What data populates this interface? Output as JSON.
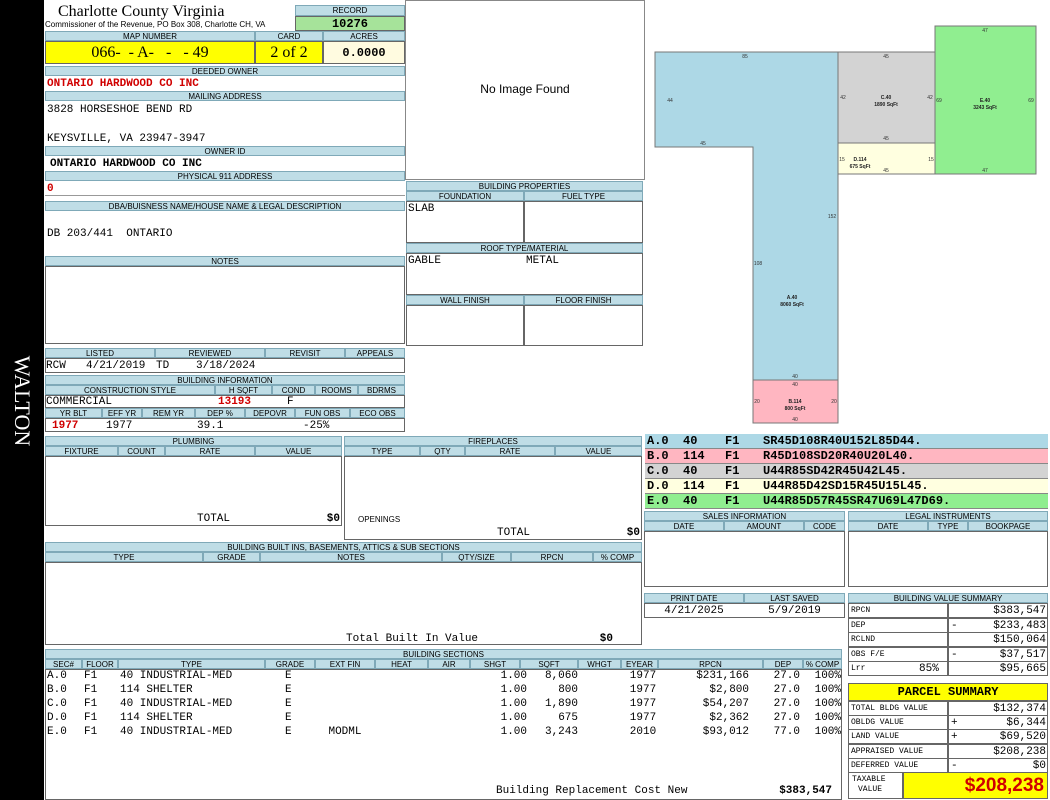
{
  "sidebar_name": "WALTON",
  "header": {
    "county": "Charlotte County Virginia",
    "address": "Commissioner of the Revenue, PO Box 308, Charlotte CH, VA",
    "record_label": "RECORD",
    "record": "10276"
  },
  "parcel": {
    "map_label": "MAP NUMBER",
    "map": "066-  - A-   -   - 49",
    "card_label": "CARD",
    "card": "2 of 2",
    "acres_label": "ACRES",
    "acres": "0.0000"
  },
  "owner": {
    "deeded_label": "DEEDED OWNER",
    "deeded": "ONTARIO HARDWOOD CO INC",
    "mailing_label": "MAILING ADDRESS",
    "addr1": "3828 HORSESHOE BEND RD",
    "addr2": "KEYSVILLE, VA 23947-3947",
    "owner_id_label": "OWNER ID",
    "owner_id": "ONTARIO HARDWOOD CO INC",
    "phys_label": "PHYSICAL 911 ADDRESS",
    "phys": "0"
  },
  "dba": {
    "label": "DBA/BUISNESS NAME/HOUSE NAME & LEGAL DESCRIPTION",
    "value": "DB 203/441  ONTARIO"
  },
  "notes": {
    "label": "NOTES"
  },
  "image": {
    "text": "No Image Found"
  },
  "bprops": {
    "title": "BUILDING PROPERTIES",
    "foundation_label": "FOUNDATION",
    "foundation": "SLAB",
    "fuel_label": "FUEL TYPE",
    "roof_label": "ROOF TYPE/MATERIAL",
    "roof_type": "GABLE",
    "roof_material": "METAL",
    "wall_label": "WALL FINISH",
    "floor_label": "FLOOR FINISH"
  },
  "review": {
    "listed_label": "LISTED",
    "listed_by": "RCW",
    "listed_date": "4/21/2019",
    "reviewed_label": "REVIEWED",
    "reviewed_by": "TD",
    "reviewed_date": "3/18/2024",
    "revisit_label": "REVISIT",
    "appeals_label": "APPEALS"
  },
  "binfo": {
    "title": "BUILDING INFORMATION",
    "cs_label": "CONSTRUCTION STYLE",
    "cs": "COMMERCIAL",
    "hsqft_label": "H SQFT",
    "hsqft": "13193",
    "cond_label": "COND",
    "cond": "F",
    "rooms_label": "ROOMS",
    "bdrms_label": "BDRMS",
    "yrblt_label": "YR BLT",
    "yrblt": "1977",
    "effyr_label": "EFF YR",
    "effyr": "1977",
    "remyr_label": "REM YR",
    "dep_label": "DEP %",
    "dep": "39.1",
    "depovr_label": "DEPOVR",
    "funobs_label": "FUN OBS",
    "funobs": "-25%",
    "ecoobs_label": "ECO OBS"
  },
  "plumbing": {
    "title": "PLUMBING",
    "cols": [
      "FIXTURE",
      "COUNT",
      "RATE",
      "VALUE"
    ],
    "total_label": "TOTAL",
    "total": "$0"
  },
  "fireplaces": {
    "title": "FIREPLACES",
    "cols": [
      "TYPE",
      "QTY",
      "RATE",
      "VALUE"
    ],
    "openings_label": "OPENINGS",
    "total_label": "TOTAL",
    "total": "$0"
  },
  "builtins": {
    "title": "BUILDING BUILT INS, BASEMENTS, ATTICS & SUB SECTIONS",
    "cols": [
      "TYPE",
      "GRADE",
      "NOTES",
      "QTY/SIZE",
      "RPCN",
      "% COMP"
    ],
    "total_label": "Total Built In Value",
    "total": "$0"
  },
  "sections": {
    "title": "BUILDING SECTIONS",
    "cols": [
      "SEC#",
      "FLOOR",
      "TYPE",
      "GRADE",
      "EXT FIN",
      "HEAT",
      "AIR",
      "SHGT",
      "SQFT",
      "WHGT",
      "EYEAR",
      "RPCN",
      "DEP",
      "% COMP"
    ],
    "rows": [
      [
        "A.0",
        "F1",
        "40 INDUSTRIAL-MED",
        "E",
        "",
        "",
        "",
        "1.00",
        "8,060",
        "",
        "1977",
        "$231,166",
        "27.0",
        "100%"
      ],
      [
        "B.0",
        "F1",
        "114 SHELTER",
        "E",
        "",
        "",
        "",
        "1.00",
        "800",
        "",
        "1977",
        "$2,800",
        "27.0",
        "100%"
      ],
      [
        "C.0",
        "F1",
        "40 INDUSTRIAL-MED",
        "E",
        "",
        "",
        "",
        "1.00",
        "1,890",
        "",
        "1977",
        "$54,207",
        "27.0",
        "100%"
      ],
      [
        "D.0",
        "F1",
        "114 SHELTER",
        "E",
        "",
        "",
        "",
        "1.00",
        "675",
        "",
        "1977",
        "$2,362",
        "27.0",
        "100%"
      ],
      [
        "E.0",
        "F1",
        "40 INDUSTRIAL-MED",
        "E",
        "MODML",
        "",
        "",
        "1.00",
        "3,243",
        "",
        "2010",
        "$93,012",
        "77.0",
        "100%"
      ]
    ],
    "brcn_label": "Building Replacement Cost New",
    "brcn": "$383,547"
  },
  "sketch": {
    "labels": [
      {
        "id": "A.40",
        "name": "A.40",
        "area": "8060 SqFt",
        "color": "#add8e6"
      },
      {
        "id": "B.114",
        "name": "B.114",
        "area": "800 SqFt",
        "color": "#ffb6c1"
      },
      {
        "id": "C.40",
        "name": "C.40",
        "area": "1890 SqFt",
        "color": "#d3d3d3"
      },
      {
        "id": "D.114",
        "name": "D.114",
        "area": "675 SqFt",
        "color": "#ffffe0"
      },
      {
        "id": "E.40",
        "name": "E.40",
        "area": "3243 SqFt",
        "color": "#90ee90"
      }
    ],
    "dims": [
      "85",
      "44",
      "45",
      "152",
      "108",
      "40",
      "40",
      "20",
      "20",
      "40",
      "45",
      "42",
      "42",
      "45",
      "15",
      "15",
      "45",
      "47",
      "69",
      "69",
      "47"
    ]
  },
  "vectors": [
    {
      "sec": "A.0",
      "code": "40",
      "floor": "F1",
      "vec": "SR45D108R40U152L85D44.",
      "color": "#add8e6"
    },
    {
      "sec": "B.0",
      "code": "114",
      "floor": "F1",
      "vec": "R45D108SD20R40U20L40.",
      "color": "#ffb6c1"
    },
    {
      "sec": "C.0",
      "code": "40",
      "floor": "F1",
      "vec": "U44R85SD42R45U42L45.",
      "color": "#d3d3d3"
    },
    {
      "sec": "D.0",
      "code": "114",
      "floor": "F1",
      "vec": "U44R85D42SD15R45U15L45.",
      "color": "#ffffe0"
    },
    {
      "sec": "E.0",
      "code": "40",
      "floor": "F1",
      "vec": "U44R85D57R45SR47U69L47D69.",
      "color": "#90ee90"
    }
  ],
  "sales": {
    "title": "SALES INFORMATION",
    "cols": [
      "DATE",
      "AMOUNT",
      "CODE"
    ]
  },
  "legal": {
    "title": "LEGAL INSTRUMENTS",
    "cols": [
      "DATE",
      "TYPE",
      "BOOKPAGE"
    ]
  },
  "dates": {
    "print_label": "PRINT DATE",
    "print": "4/21/2025",
    "saved_label": "LAST SAVED",
    "saved": "5/9/2019"
  },
  "bvs": {
    "title": "BUILDING VALUE SUMMARY",
    "rows": [
      {
        "label": "RPCN",
        "sign": "",
        "value": "$383,547"
      },
      {
        "label": "DEP",
        "sign": "-",
        "value": "$233,483"
      },
      {
        "label": "RCLND",
        "sign": "",
        "value": "$150,064"
      },
      {
        "label": "OBS F/E",
        "sign": "-",
        "value": "$37,517"
      },
      {
        "label": "Lrr",
        "pct": "85%",
        "sign": "",
        "value": "$95,665"
      }
    ]
  },
  "summary": {
    "title": "PARCEL SUMMARY",
    "rows": [
      {
        "label": "TOTAL BLDG VALUE",
        "sign": "",
        "value": "$132,374"
      },
      {
        "label": "OBLDG VALUE",
        "sign": "+",
        "value": "$6,344"
      },
      {
        "label": "LAND VALUE",
        "sign": "+",
        "value": "$69,520"
      },
      {
        "label": "APPRAISED VALUE",
        "sign": "",
        "value": "$208,238"
      },
      {
        "label": "DEFERRED VALUE",
        "sign": "-",
        "value": "$0"
      }
    ],
    "taxable_label1": "TAXABLE",
    "taxable_label2": "VALUE",
    "taxable": "$208,238"
  }
}
